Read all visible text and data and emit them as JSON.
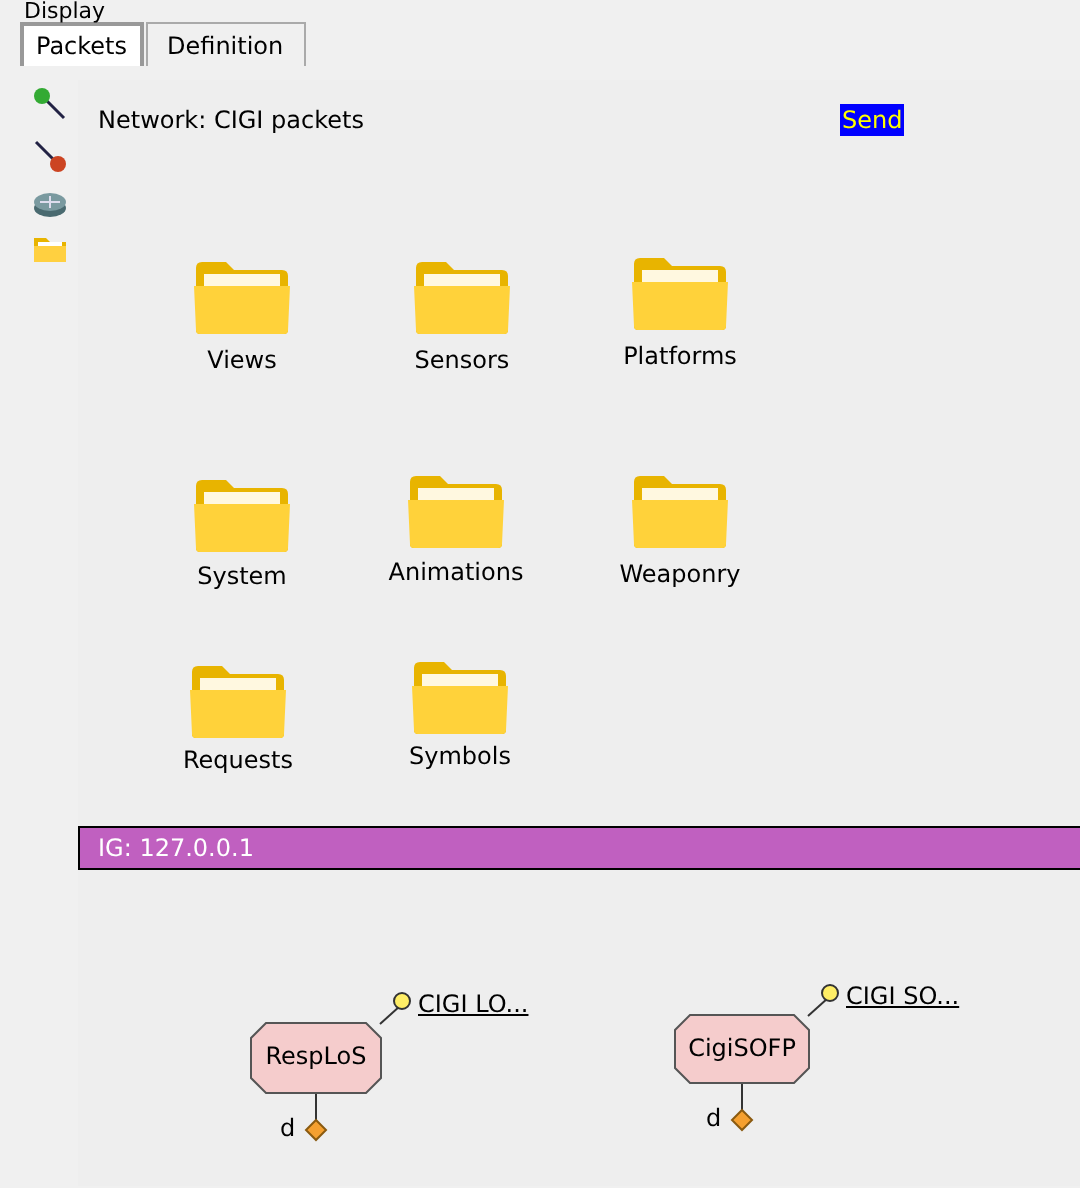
{
  "menu_label": "Display",
  "tabs": [
    {
      "label": "Packets",
      "selected": true
    },
    {
      "label": "Definition",
      "selected": false
    }
  ],
  "network_label": "Network: CIGI packets",
  "send_button": "Send",
  "folders": [
    {
      "label": "Views"
    },
    {
      "label": "Sensors"
    },
    {
      "label": "Platforms"
    },
    {
      "label": "System"
    },
    {
      "label": "Animations"
    },
    {
      "label": "Weaponry"
    },
    {
      "label": "Requests"
    },
    {
      "label": "Symbols"
    }
  ],
  "ig_bar": {
    "label": "IG: 127.0.0.1"
  },
  "nodes": [
    {
      "name": "RespLoS",
      "link": "CIGI LO...",
      "port": "d"
    },
    {
      "name": "CigiSOFP",
      "link": "CIGI SO...",
      "port": "d"
    }
  ]
}
